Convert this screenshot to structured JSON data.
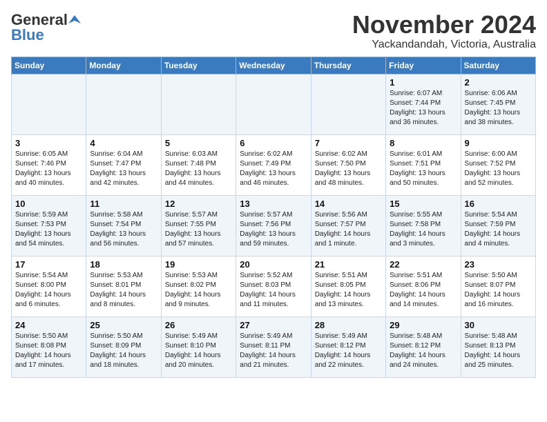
{
  "header": {
    "logo_general": "General",
    "logo_blue": "Blue",
    "month_title": "November 2024",
    "location": "Yackandandah, Victoria, Australia"
  },
  "weekdays": [
    "Sunday",
    "Monday",
    "Tuesday",
    "Wednesday",
    "Thursday",
    "Friday",
    "Saturday"
  ],
  "weeks": [
    [
      {
        "day": "",
        "sunrise": "",
        "sunset": "",
        "daylight": ""
      },
      {
        "day": "",
        "sunrise": "",
        "sunset": "",
        "daylight": ""
      },
      {
        "day": "",
        "sunrise": "",
        "sunset": "",
        "daylight": ""
      },
      {
        "day": "",
        "sunrise": "",
        "sunset": "",
        "daylight": ""
      },
      {
        "day": "",
        "sunrise": "",
        "sunset": "",
        "daylight": ""
      },
      {
        "day": "1",
        "sunrise": "Sunrise: 6:07 AM",
        "sunset": "Sunset: 7:44 PM",
        "daylight": "Daylight: 13 hours and 36 minutes."
      },
      {
        "day": "2",
        "sunrise": "Sunrise: 6:06 AM",
        "sunset": "Sunset: 7:45 PM",
        "daylight": "Daylight: 13 hours and 38 minutes."
      }
    ],
    [
      {
        "day": "3",
        "sunrise": "Sunrise: 6:05 AM",
        "sunset": "Sunset: 7:46 PM",
        "daylight": "Daylight: 13 hours and 40 minutes."
      },
      {
        "day": "4",
        "sunrise": "Sunrise: 6:04 AM",
        "sunset": "Sunset: 7:47 PM",
        "daylight": "Daylight: 13 hours and 42 minutes."
      },
      {
        "day": "5",
        "sunrise": "Sunrise: 6:03 AM",
        "sunset": "Sunset: 7:48 PM",
        "daylight": "Daylight: 13 hours and 44 minutes."
      },
      {
        "day": "6",
        "sunrise": "Sunrise: 6:02 AM",
        "sunset": "Sunset: 7:49 PM",
        "daylight": "Daylight: 13 hours and 46 minutes."
      },
      {
        "day": "7",
        "sunrise": "Sunrise: 6:02 AM",
        "sunset": "Sunset: 7:50 PM",
        "daylight": "Daylight: 13 hours and 48 minutes."
      },
      {
        "day": "8",
        "sunrise": "Sunrise: 6:01 AM",
        "sunset": "Sunset: 7:51 PM",
        "daylight": "Daylight: 13 hours and 50 minutes."
      },
      {
        "day": "9",
        "sunrise": "Sunrise: 6:00 AM",
        "sunset": "Sunset: 7:52 PM",
        "daylight": "Daylight: 13 hours and 52 minutes."
      }
    ],
    [
      {
        "day": "10",
        "sunrise": "Sunrise: 5:59 AM",
        "sunset": "Sunset: 7:53 PM",
        "daylight": "Daylight: 13 hours and 54 minutes."
      },
      {
        "day": "11",
        "sunrise": "Sunrise: 5:58 AM",
        "sunset": "Sunset: 7:54 PM",
        "daylight": "Daylight: 13 hours and 56 minutes."
      },
      {
        "day": "12",
        "sunrise": "Sunrise: 5:57 AM",
        "sunset": "Sunset: 7:55 PM",
        "daylight": "Daylight: 13 hours and 57 minutes."
      },
      {
        "day": "13",
        "sunrise": "Sunrise: 5:57 AM",
        "sunset": "Sunset: 7:56 PM",
        "daylight": "Daylight: 13 hours and 59 minutes."
      },
      {
        "day": "14",
        "sunrise": "Sunrise: 5:56 AM",
        "sunset": "Sunset: 7:57 PM",
        "daylight": "Daylight: 14 hours and 1 minute."
      },
      {
        "day": "15",
        "sunrise": "Sunrise: 5:55 AM",
        "sunset": "Sunset: 7:58 PM",
        "daylight": "Daylight: 14 hours and 3 minutes."
      },
      {
        "day": "16",
        "sunrise": "Sunrise: 5:54 AM",
        "sunset": "Sunset: 7:59 PM",
        "daylight": "Daylight: 14 hours and 4 minutes."
      }
    ],
    [
      {
        "day": "17",
        "sunrise": "Sunrise: 5:54 AM",
        "sunset": "Sunset: 8:00 PM",
        "daylight": "Daylight: 14 hours and 6 minutes."
      },
      {
        "day": "18",
        "sunrise": "Sunrise: 5:53 AM",
        "sunset": "Sunset: 8:01 PM",
        "daylight": "Daylight: 14 hours and 8 minutes."
      },
      {
        "day": "19",
        "sunrise": "Sunrise: 5:53 AM",
        "sunset": "Sunset: 8:02 PM",
        "daylight": "Daylight: 14 hours and 9 minutes."
      },
      {
        "day": "20",
        "sunrise": "Sunrise: 5:52 AM",
        "sunset": "Sunset: 8:03 PM",
        "daylight": "Daylight: 14 hours and 11 minutes."
      },
      {
        "day": "21",
        "sunrise": "Sunrise: 5:51 AM",
        "sunset": "Sunset: 8:05 PM",
        "daylight": "Daylight: 14 hours and 13 minutes."
      },
      {
        "day": "22",
        "sunrise": "Sunrise: 5:51 AM",
        "sunset": "Sunset: 8:06 PM",
        "daylight": "Daylight: 14 hours and 14 minutes."
      },
      {
        "day": "23",
        "sunrise": "Sunrise: 5:50 AM",
        "sunset": "Sunset: 8:07 PM",
        "daylight": "Daylight: 14 hours and 16 minutes."
      }
    ],
    [
      {
        "day": "24",
        "sunrise": "Sunrise: 5:50 AM",
        "sunset": "Sunset: 8:08 PM",
        "daylight": "Daylight: 14 hours and 17 minutes."
      },
      {
        "day": "25",
        "sunrise": "Sunrise: 5:50 AM",
        "sunset": "Sunset: 8:09 PM",
        "daylight": "Daylight: 14 hours and 18 minutes."
      },
      {
        "day": "26",
        "sunrise": "Sunrise: 5:49 AM",
        "sunset": "Sunset: 8:10 PM",
        "daylight": "Daylight: 14 hours and 20 minutes."
      },
      {
        "day": "27",
        "sunrise": "Sunrise: 5:49 AM",
        "sunset": "Sunset: 8:11 PM",
        "daylight": "Daylight: 14 hours and 21 minutes."
      },
      {
        "day": "28",
        "sunrise": "Sunrise: 5:49 AM",
        "sunset": "Sunset: 8:12 PM",
        "daylight": "Daylight: 14 hours and 22 minutes."
      },
      {
        "day": "29",
        "sunrise": "Sunrise: 5:48 AM",
        "sunset": "Sunset: 8:12 PM",
        "daylight": "Daylight: 14 hours and 24 minutes."
      },
      {
        "day": "30",
        "sunrise": "Sunrise: 5:48 AM",
        "sunset": "Sunset: 8:13 PM",
        "daylight": "Daylight: 14 hours and 25 minutes."
      }
    ]
  ]
}
